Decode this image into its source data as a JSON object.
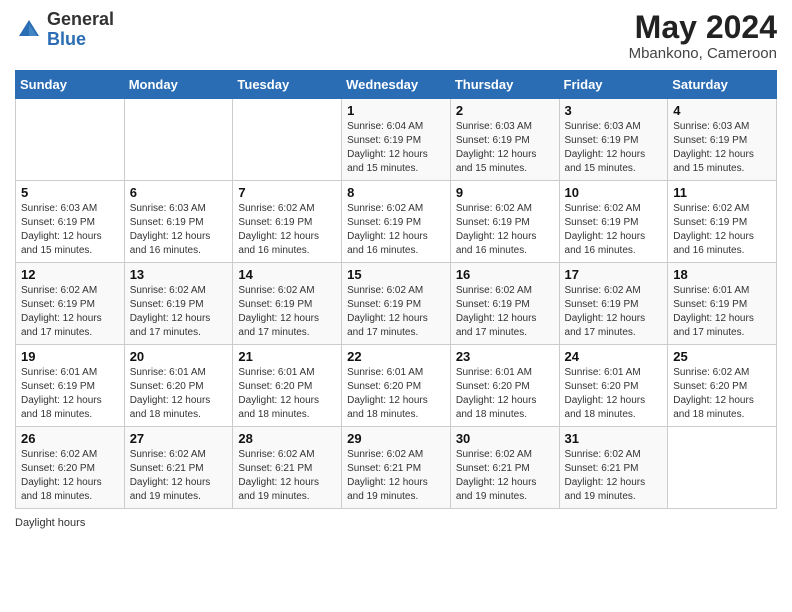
{
  "header": {
    "logo_general": "General",
    "logo_blue": "Blue",
    "main_title": "May 2024",
    "subtitle": "Mbankono, Cameroon"
  },
  "days_of_week": [
    "Sunday",
    "Monday",
    "Tuesday",
    "Wednesday",
    "Thursday",
    "Friday",
    "Saturday"
  ],
  "footer": {
    "note": "Daylight hours"
  },
  "weeks": [
    [
      {
        "day": "",
        "info": ""
      },
      {
        "day": "",
        "info": ""
      },
      {
        "day": "",
        "info": ""
      },
      {
        "day": "1",
        "info": "Sunrise: 6:04 AM\nSunset: 6:19 PM\nDaylight: 12 hours\nand 15 minutes."
      },
      {
        "day": "2",
        "info": "Sunrise: 6:03 AM\nSunset: 6:19 PM\nDaylight: 12 hours\nand 15 minutes."
      },
      {
        "day": "3",
        "info": "Sunrise: 6:03 AM\nSunset: 6:19 PM\nDaylight: 12 hours\nand 15 minutes."
      },
      {
        "day": "4",
        "info": "Sunrise: 6:03 AM\nSunset: 6:19 PM\nDaylight: 12 hours\nand 15 minutes."
      }
    ],
    [
      {
        "day": "5",
        "info": "Sunrise: 6:03 AM\nSunset: 6:19 PM\nDaylight: 12 hours\nand 15 minutes."
      },
      {
        "day": "6",
        "info": "Sunrise: 6:03 AM\nSunset: 6:19 PM\nDaylight: 12 hours\nand 16 minutes."
      },
      {
        "day": "7",
        "info": "Sunrise: 6:02 AM\nSunset: 6:19 PM\nDaylight: 12 hours\nand 16 minutes."
      },
      {
        "day": "8",
        "info": "Sunrise: 6:02 AM\nSunset: 6:19 PM\nDaylight: 12 hours\nand 16 minutes."
      },
      {
        "day": "9",
        "info": "Sunrise: 6:02 AM\nSunset: 6:19 PM\nDaylight: 12 hours\nand 16 minutes."
      },
      {
        "day": "10",
        "info": "Sunrise: 6:02 AM\nSunset: 6:19 PM\nDaylight: 12 hours\nand 16 minutes."
      },
      {
        "day": "11",
        "info": "Sunrise: 6:02 AM\nSunset: 6:19 PM\nDaylight: 12 hours\nand 16 minutes."
      }
    ],
    [
      {
        "day": "12",
        "info": "Sunrise: 6:02 AM\nSunset: 6:19 PM\nDaylight: 12 hours\nand 17 minutes."
      },
      {
        "day": "13",
        "info": "Sunrise: 6:02 AM\nSunset: 6:19 PM\nDaylight: 12 hours\nand 17 minutes."
      },
      {
        "day": "14",
        "info": "Sunrise: 6:02 AM\nSunset: 6:19 PM\nDaylight: 12 hours\nand 17 minutes."
      },
      {
        "day": "15",
        "info": "Sunrise: 6:02 AM\nSunset: 6:19 PM\nDaylight: 12 hours\nand 17 minutes."
      },
      {
        "day": "16",
        "info": "Sunrise: 6:02 AM\nSunset: 6:19 PM\nDaylight: 12 hours\nand 17 minutes."
      },
      {
        "day": "17",
        "info": "Sunrise: 6:02 AM\nSunset: 6:19 PM\nDaylight: 12 hours\nand 17 minutes."
      },
      {
        "day": "18",
        "info": "Sunrise: 6:01 AM\nSunset: 6:19 PM\nDaylight: 12 hours\nand 17 minutes."
      }
    ],
    [
      {
        "day": "19",
        "info": "Sunrise: 6:01 AM\nSunset: 6:19 PM\nDaylight: 12 hours\nand 18 minutes."
      },
      {
        "day": "20",
        "info": "Sunrise: 6:01 AM\nSunset: 6:20 PM\nDaylight: 12 hours\nand 18 minutes."
      },
      {
        "day": "21",
        "info": "Sunrise: 6:01 AM\nSunset: 6:20 PM\nDaylight: 12 hours\nand 18 minutes."
      },
      {
        "day": "22",
        "info": "Sunrise: 6:01 AM\nSunset: 6:20 PM\nDaylight: 12 hours\nand 18 minutes."
      },
      {
        "day": "23",
        "info": "Sunrise: 6:01 AM\nSunset: 6:20 PM\nDaylight: 12 hours\nand 18 minutes."
      },
      {
        "day": "24",
        "info": "Sunrise: 6:01 AM\nSunset: 6:20 PM\nDaylight: 12 hours\nand 18 minutes."
      },
      {
        "day": "25",
        "info": "Sunrise: 6:02 AM\nSunset: 6:20 PM\nDaylight: 12 hours\nand 18 minutes."
      }
    ],
    [
      {
        "day": "26",
        "info": "Sunrise: 6:02 AM\nSunset: 6:20 PM\nDaylight: 12 hours\nand 18 minutes."
      },
      {
        "day": "27",
        "info": "Sunrise: 6:02 AM\nSunset: 6:21 PM\nDaylight: 12 hours\nand 19 minutes."
      },
      {
        "day": "28",
        "info": "Sunrise: 6:02 AM\nSunset: 6:21 PM\nDaylight: 12 hours\nand 19 minutes."
      },
      {
        "day": "29",
        "info": "Sunrise: 6:02 AM\nSunset: 6:21 PM\nDaylight: 12 hours\nand 19 minutes."
      },
      {
        "day": "30",
        "info": "Sunrise: 6:02 AM\nSunset: 6:21 PM\nDaylight: 12 hours\nand 19 minutes."
      },
      {
        "day": "31",
        "info": "Sunrise: 6:02 AM\nSunset: 6:21 PM\nDaylight: 12 hours\nand 19 minutes."
      },
      {
        "day": "",
        "info": ""
      }
    ]
  ]
}
